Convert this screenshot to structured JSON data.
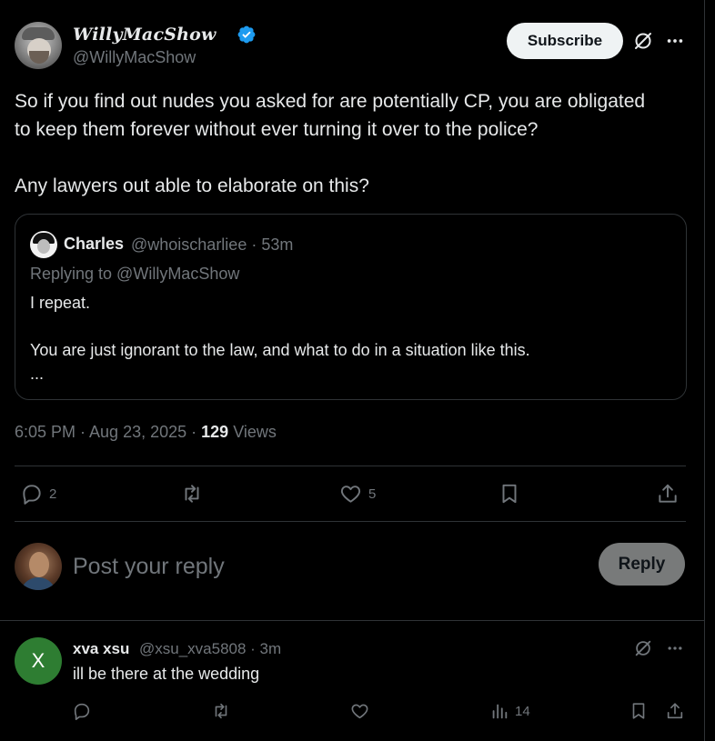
{
  "tweet": {
    "author_name": "WillyMacShow",
    "author_handle": "@WillyMacShow",
    "subscribe_label": "Subscribe",
    "text_line1": "So if you find out nudes you asked for are potentially CP, you are obligated",
    "text_line2": "to keep them forever without ever turning it over to the police?",
    "text_line3": "Any lawyers out able to elaborate on this?",
    "quote": {
      "name": "Charles",
      "meta": "@whoischarliee · 53m",
      "replying_to": "Replying to @WillyMacShow",
      "text_line1": "I repeat.",
      "text_line2": "You are just ignorant to the law, and what to do in a situation like this.",
      "text_line3": "..."
    },
    "timestamp": "6:05 PM · Aug 23, 2025 · ",
    "views_count": "129",
    "views_label": " Views",
    "actions": {
      "replies": "2",
      "likes": "5"
    }
  },
  "composer": {
    "placeholder": "Post your reply",
    "reply_label": "Reply"
  },
  "reply": {
    "avatar_letter": "X",
    "name": "xva xsu",
    "meta": "@xsu_xva5808 · 3m",
    "text": "ill be there at the wedding",
    "views": "14"
  },
  "colors": {
    "background": "#000000",
    "text": "#e7e9ea",
    "muted": "#71767b",
    "border": "#2f3336",
    "verified": "#1d9bf0",
    "reply_avatar": "#2e7d32"
  },
  "icons": [
    "verified-badge-icon",
    "grok-icon",
    "more-icon",
    "reply-icon",
    "repost-icon",
    "like-icon",
    "bookmark-icon",
    "share-icon",
    "views-icon"
  ]
}
